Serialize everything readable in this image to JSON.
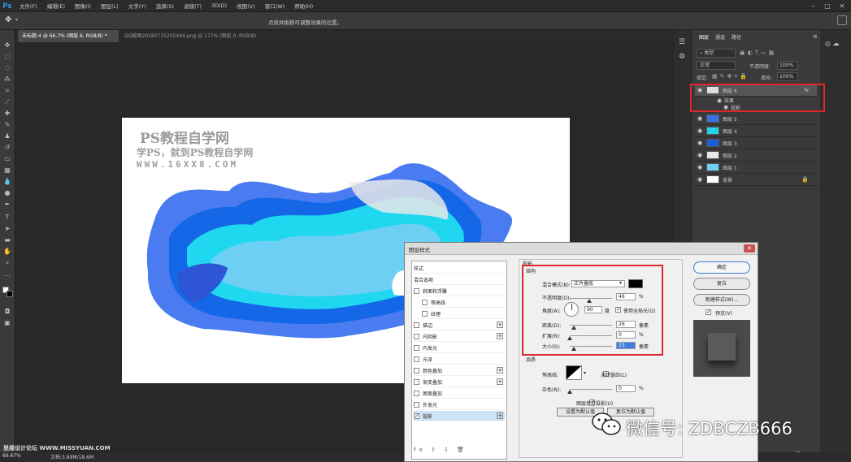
{
  "menubar": {
    "logo": "Ps",
    "items": [
      "文件(F)",
      "编辑(E)",
      "图像(I)",
      "图层(L)",
      "文字(Y)",
      "选择(S)",
      "滤镜(T)",
      "3D(D)",
      "视图(V)",
      "窗口(W)",
      "帮助(H)"
    ]
  },
  "options": {
    "hint": "点按并拖移可调整效果的位置。"
  },
  "tabs": [
    {
      "label": "未标题-4 @ 66.7% (图层 6, RGB/8) *"
    },
    {
      "label": "QQ截图20180715205444.png @ 177% (图层 0, RGB/8)"
    }
  ],
  "watermark": {
    "line1": "PS教程自学网",
    "line2": "学PS，就到PS教程自学网",
    "line3": "WWW.16XX8.COM"
  },
  "layers_panel": {
    "tabs": [
      "图层",
      "通道",
      "路径"
    ],
    "kind_label": "类型",
    "blend_mode": "正常",
    "opacity_label": "不透明度:",
    "opacity_value": "100%",
    "lock_label": "锁定:",
    "fill_label": "填充:",
    "fill_value": "100%",
    "layers": [
      {
        "name": "图层 6",
        "fx": "fx"
      },
      {
        "name": "效果"
      },
      {
        "name": "投影"
      },
      {
        "name": "图层 5"
      },
      {
        "name": "图层 4"
      },
      {
        "name": "图层 3"
      },
      {
        "name": "图层 2"
      },
      {
        "name": "图层 1"
      },
      {
        "name": "背景"
      }
    ]
  },
  "statusbar": {
    "zoom": "66.67%",
    "doc": "文档:3.89M/18.6M",
    "site": "思缘设计论坛 WWW.MISSYUAN.COM"
  },
  "wechat": {
    "text": "微信号: ZDBCZB666"
  },
  "dialog": {
    "title": "图层样式",
    "styles_header": "样式",
    "blend_options": "混合选项",
    "styles": [
      {
        "label": "斜面和浮雕"
      },
      {
        "label": "等高线"
      },
      {
        "label": "纹理"
      },
      {
        "label": "描边",
        "plus": "+"
      },
      {
        "label": "内阴影",
        "plus": "+"
      },
      {
        "label": "内发光"
      },
      {
        "label": "光泽"
      },
      {
        "label": "颜色叠加",
        "plus": "+"
      },
      {
        "label": "渐变叠加",
        "plus": "+"
      },
      {
        "label": "图案叠加"
      },
      {
        "label": "外发光"
      },
      {
        "label": "投影",
        "plus": "+"
      }
    ],
    "section_title": "投影",
    "structure_label": "结构",
    "blend_mode_label": "混合模式(B):",
    "blend_mode_value": "正片叠底",
    "opacity_label": "不透明度(O):",
    "opacity_value": "46",
    "percent": "%",
    "angle_label": "角度(A):",
    "angle_value": "90",
    "degree": "度",
    "global_light_label": "使用全局光(G)",
    "distance_label": "距离(D):",
    "distance_value": "26",
    "spread_label": "扩展(R):",
    "spread_value": "0",
    "size_label": "大小(S):",
    "size_value": "23",
    "pixels": "像素",
    "quality_label": "品质",
    "contour_label": "等高线:",
    "antialias_label": "消除锯齿(L)",
    "noise_label": "杂色(N):",
    "noise_value": "0",
    "knockout_label": "图层挖空投影(U)",
    "set_default": "设置为默认值",
    "reset_default": "复位为默认值",
    "ok": "确定",
    "reset": "复位",
    "new_style": "新建样式(W)...",
    "preview_label": "预览(V)",
    "opacity_fraction": 0.46,
    "distance_fraction": 0.1,
    "spread_fraction": 0,
    "size_fraction": 0.09,
    "noise_fraction": 0
  }
}
